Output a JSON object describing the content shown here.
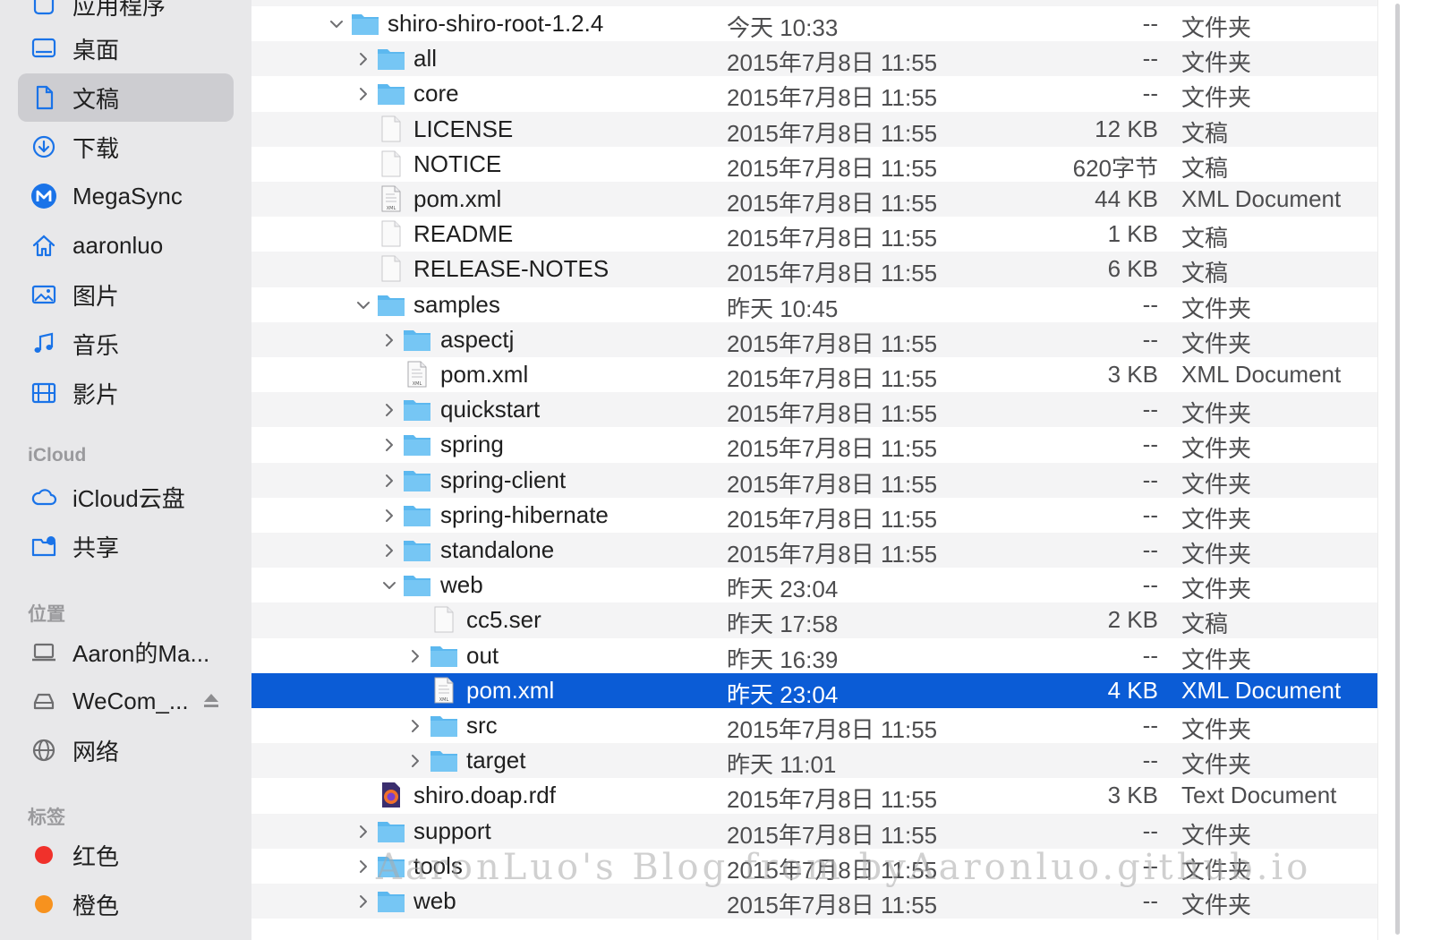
{
  "sidebar": {
    "items": [
      {
        "label": "应用程序",
        "icon": "applications-icon"
      },
      {
        "label": "桌面",
        "icon": "desktop-icon"
      },
      {
        "label": "文稿",
        "icon": "documents-icon"
      },
      {
        "label": "下载",
        "icon": "downloads-icon"
      },
      {
        "label": "MegaSync",
        "icon": "megasync-icon"
      },
      {
        "label": "aaronluo",
        "icon": "home-icon"
      },
      {
        "label": "图片",
        "icon": "pictures-icon"
      },
      {
        "label": "音乐",
        "icon": "music-icon"
      },
      {
        "label": "影片",
        "icon": "movies-icon"
      }
    ],
    "selected": "文稿",
    "icloud_header": "iCloud",
    "icloud_items": [
      {
        "label": "iCloud云盘",
        "icon": "cloud-icon"
      },
      {
        "label": "共享",
        "icon": "shared-folder-icon"
      }
    ],
    "locations_header": "位置",
    "location_items": [
      {
        "label": "Aaron的Ma...",
        "icon": "laptop-icon"
      },
      {
        "label": "WeCom_...",
        "icon": "drive-icon"
      },
      {
        "label": "网络",
        "icon": "network-icon"
      }
    ],
    "tags_header": "标签",
    "tag_items": [
      {
        "label": "红色",
        "color": "#f0312b"
      },
      {
        "label": "橙色",
        "color": "#f7921e"
      }
    ]
  },
  "files": [
    {
      "name": "shiro-shiro-root-1.2.4",
      "date": "今天 10:33",
      "size": "--",
      "kind": "文件夹",
      "type": "folder",
      "depth": 0,
      "expanded": true
    },
    {
      "name": "all",
      "date": "2015年7月8日 11:55",
      "size": "--",
      "kind": "文件夹",
      "type": "folder",
      "depth": 1,
      "expanded": false
    },
    {
      "name": "core",
      "date": "2015年7月8日 11:55",
      "size": "--",
      "kind": "文件夹",
      "type": "folder",
      "depth": 1,
      "expanded": false
    },
    {
      "name": "LICENSE",
      "date": "2015年7月8日 11:55",
      "size": "12 KB",
      "kind": "文稿",
      "type": "doc",
      "depth": 1
    },
    {
      "name": "NOTICE",
      "date": "2015年7月8日 11:55",
      "size": "620字节",
      "kind": "文稿",
      "type": "doc",
      "depth": 1
    },
    {
      "name": "pom.xml",
      "date": "2015年7月8日 11:55",
      "size": "44 KB",
      "kind": "XML Document",
      "type": "xml",
      "depth": 1
    },
    {
      "name": "README",
      "date": "2015年7月8日 11:55",
      "size": "1 KB",
      "kind": "文稿",
      "type": "doc",
      "depth": 1
    },
    {
      "name": "RELEASE-NOTES",
      "date": "2015年7月8日 11:55",
      "size": "6 KB",
      "kind": "文稿",
      "type": "doc",
      "depth": 1
    },
    {
      "name": "samples",
      "date": "昨天 10:45",
      "size": "--",
      "kind": "文件夹",
      "type": "folder",
      "depth": 1,
      "expanded": true
    },
    {
      "name": "aspectj",
      "date": "2015年7月8日 11:55",
      "size": "--",
      "kind": "文件夹",
      "type": "folder",
      "depth": 2,
      "expanded": false
    },
    {
      "name": "pom.xml",
      "date": "2015年7月8日 11:55",
      "size": "3 KB",
      "kind": "XML Document",
      "type": "xml",
      "depth": 2
    },
    {
      "name": "quickstart",
      "date": "2015年7月8日 11:55",
      "size": "--",
      "kind": "文件夹",
      "type": "folder",
      "depth": 2,
      "expanded": false
    },
    {
      "name": "spring",
      "date": "2015年7月8日 11:55",
      "size": "--",
      "kind": "文件夹",
      "type": "folder",
      "depth": 2,
      "expanded": false
    },
    {
      "name": "spring-client",
      "date": "2015年7月8日 11:55",
      "size": "--",
      "kind": "文件夹",
      "type": "folder",
      "depth": 2,
      "expanded": false
    },
    {
      "name": "spring-hibernate",
      "date": "2015年7月8日 11:55",
      "size": "--",
      "kind": "文件夹",
      "type": "folder",
      "depth": 2,
      "expanded": false
    },
    {
      "name": "standalone",
      "date": "2015年7月8日 11:55",
      "size": "--",
      "kind": "文件夹",
      "type": "folder",
      "depth": 2,
      "expanded": false
    },
    {
      "name": "web",
      "date": "昨天 23:04",
      "size": "--",
      "kind": "文件夹",
      "type": "folder",
      "depth": 2,
      "expanded": true
    },
    {
      "name": "cc5.ser",
      "date": "昨天 17:58",
      "size": "2 KB",
      "kind": "文稿",
      "type": "doc",
      "depth": 3
    },
    {
      "name": "out",
      "date": "昨天 16:39",
      "size": "--",
      "kind": "文件夹",
      "type": "folder",
      "depth": 3,
      "expanded": false
    },
    {
      "name": "pom.xml",
      "date": "昨天 23:04",
      "size": "4 KB",
      "kind": "XML Document",
      "type": "xml",
      "depth": 3,
      "selected": true
    },
    {
      "name": "src",
      "date": "2015年7月8日 11:55",
      "size": "--",
      "kind": "文件夹",
      "type": "folder",
      "depth": 3,
      "expanded": false
    },
    {
      "name": "target",
      "date": "昨天 11:01",
      "size": "--",
      "kind": "文件夹",
      "type": "folder",
      "depth": 3,
      "expanded": false
    },
    {
      "name": "shiro.doap.rdf",
      "date": "2015年7月8日 11:55",
      "size": "3 KB",
      "kind": "Text Document",
      "type": "rdf",
      "depth": 1
    },
    {
      "name": "support",
      "date": "2015年7月8日 11:55",
      "size": "--",
      "kind": "文件夹",
      "type": "folder",
      "depth": 1,
      "expanded": false
    },
    {
      "name": "tools",
      "date": "2015年7月8日 11:55",
      "size": "--",
      "kind": "文件夹",
      "type": "folder",
      "depth": 1,
      "expanded": false
    },
    {
      "name": "web",
      "date": "2015年7月8日 11:55",
      "size": "--",
      "kind": "文件夹",
      "type": "folder",
      "depth": 1,
      "expanded": false
    }
  ],
  "watermark": "AaronLuo's Blog from byAaronluo.github.io",
  "colors": {
    "selection": "#0b5cd6",
    "sidebar_icon": "#1a73e8",
    "folder": "#5cb8ef"
  }
}
